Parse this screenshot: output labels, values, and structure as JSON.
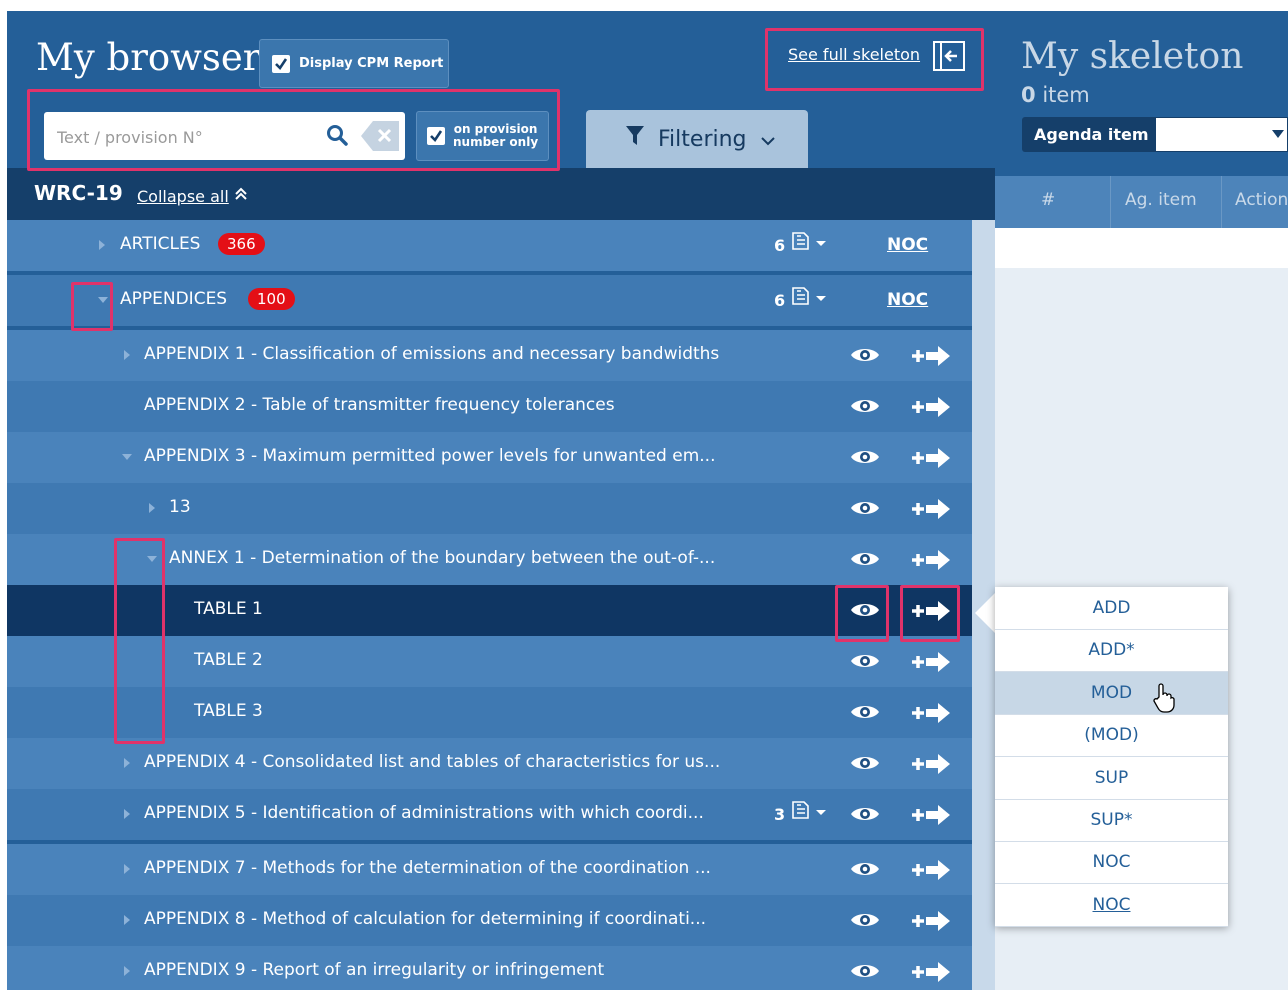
{
  "browser": {
    "title": "My browser",
    "cpm_label": "Display CPM Report",
    "search": {
      "placeholder": "Text / provision N°"
    },
    "provision_label_1": "on provision",
    "provision_label_2": "number only",
    "filter_label": "Filtering",
    "skeleton_link": "See full skeleton",
    "wrc": "WRC-19",
    "collapse_all": "Collapse all"
  },
  "tree": [
    {
      "label": "ARTICLES",
      "badge": "366",
      "doc_count": "6",
      "noc": "NOC"
    },
    {
      "label": "APPENDICES",
      "badge": "100",
      "doc_count": "6",
      "noc": "NOC"
    },
    {
      "label": "APPENDIX 1 - Classification of emissions and necessary bandwidths"
    },
    {
      "label": "APPENDIX 2 - Table of transmitter frequency tolerances"
    },
    {
      "label": "APPENDIX 3 - Maximum permitted power levels for unwanted em..."
    },
    {
      "label": "13"
    },
    {
      "label": "ANNEX 1 - Determination of the boundary between the out-of-..."
    },
    {
      "label": "TABLE 1"
    },
    {
      "label": "TABLE 2"
    },
    {
      "label": "TABLE 3"
    },
    {
      "label": "APPENDIX 4 - Consolidated list and tables of characteristics for us..."
    },
    {
      "label": "APPENDIX 5 - Identification of administrations with which coordi...",
      "doc_count": "3"
    },
    {
      "label": "APPENDIX 7 - Methods for the determination of the coordination ..."
    },
    {
      "label": "APPENDIX 8 - Method of calculation for determining if coordinati..."
    },
    {
      "label": "APPENDIX 9 - Report of an irregularity or infringement"
    }
  ],
  "skeleton": {
    "title": "My skeleton",
    "count": "0",
    "count_label": "item",
    "agenda_label": "Agenda item",
    "columns": [
      "#",
      "Ag. item",
      "Action"
    ]
  },
  "menu": [
    "ADD",
    "ADD*",
    "MOD",
    "(MOD)",
    "SUP",
    "SUP*",
    "NOC",
    "NOC"
  ],
  "colors": {
    "primary": "#245f98",
    "dark": "#153f6a",
    "badge": "#e40f16",
    "highlight": "#e0336a"
  }
}
